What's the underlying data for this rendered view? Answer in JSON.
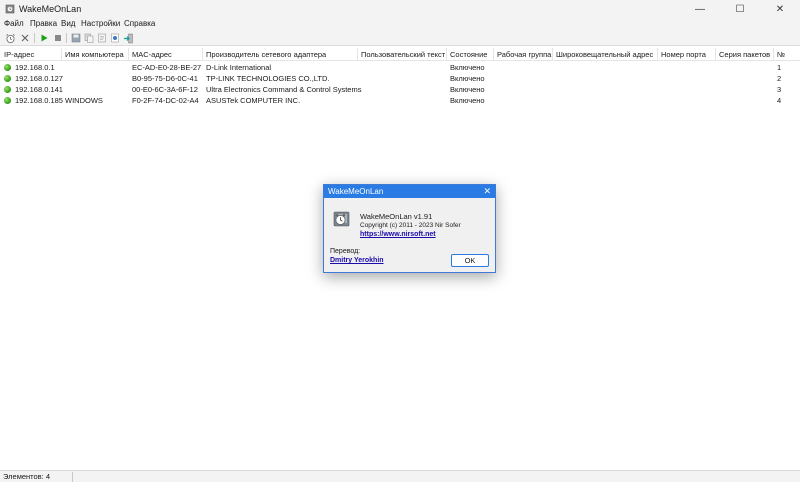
{
  "window": {
    "title": "WakeMeOnLan",
    "minimize": "—",
    "maximize": "☐",
    "close": "✕"
  },
  "menu": [
    "Файл",
    "Правка",
    "Вид",
    "Настройки",
    "Справка"
  ],
  "toolbar": {
    "icons": [
      "alarm-clock-icon",
      "stop-x-icon",
      "play-icon",
      "stop-icon",
      "save-icon",
      "copy-icon",
      "copy-html-icon",
      "properties-icon",
      "exit-icon"
    ]
  },
  "table": {
    "columns": [
      "IP-адрес",
      "Имя компьютера",
      "MAC-адрес",
      "Производитель сетевого адаптера",
      "Пользовательский текст",
      "Состояние",
      "Рабочая группа",
      "Широковещательный адрес",
      "Номер порта",
      "Серия пакетов",
      "№"
    ],
    "rows": [
      {
        "ip": "192.168.0.1",
        "name": "",
        "mac": "EC-AD-E0-28-BE-27",
        "vendor": "D-Link International",
        "custom": "",
        "state": "Включено",
        "workgroup": "",
        "broadcast": "",
        "port": "",
        "series": "",
        "num": "1"
      },
      {
        "ip": "192.168.0.127",
        "name": "",
        "mac": "B0-95-75-D6-0C-41",
        "vendor": "TP-LINK TECHNOLOGIES CO.,LTD.",
        "custom": "",
        "state": "Включено",
        "workgroup": "",
        "broadcast": "",
        "port": "",
        "series": "",
        "num": "2"
      },
      {
        "ip": "192.168.0.141",
        "name": "",
        "mac": "00-E0-6C-3A-6F-12",
        "vendor": "Ultra Electronics Command & Control Systems",
        "custom": "",
        "state": "Включено",
        "workgroup": "",
        "broadcast": "",
        "port": "",
        "series": "",
        "num": "3"
      },
      {
        "ip": "192.168.0.185",
        "name": "WINDOWS",
        "mac": "F0-2F-74-DC-02-A4",
        "vendor": "ASUSTek COMPUTER INC.",
        "custom": "",
        "state": "Включено",
        "workgroup": "",
        "broadcast": "",
        "port": "",
        "series": "",
        "num": "4"
      }
    ]
  },
  "status": {
    "text": "Элементов: 4"
  },
  "dialog": {
    "title": "WakeMeOnLan",
    "close": "✕",
    "app_name": "WakeMeOnLan v1.91",
    "copyright": "Copyright (c) 2011 - 2023 Nir Sofer",
    "link": "https://www.nirsoft.net",
    "translation_label": "Перевод:",
    "translator": "Dmitry Yerokhin",
    "ok": "OK"
  },
  "colors": {
    "accent": "#2a7be4",
    "link": "#1a0dab",
    "status_on": "#2d9a14"
  }
}
